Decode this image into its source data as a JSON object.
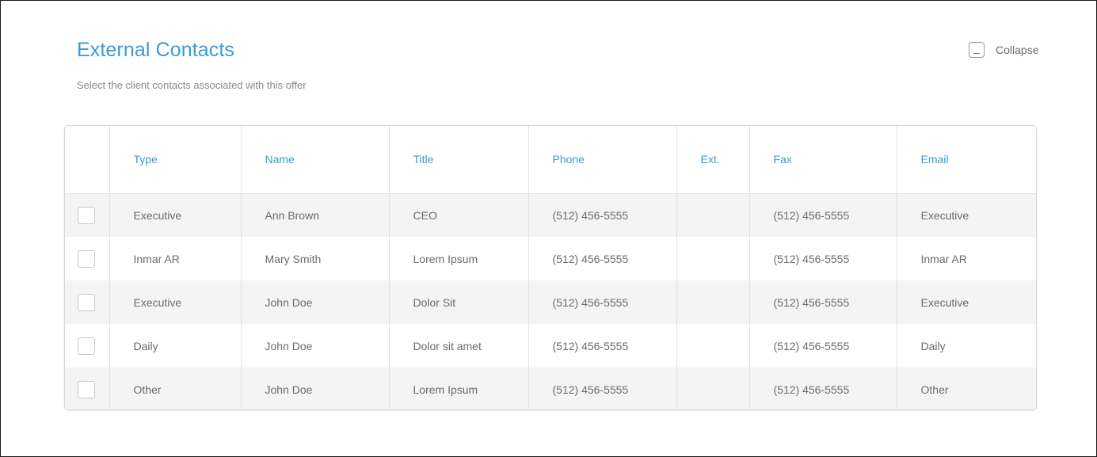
{
  "header": {
    "title": "External Contacts",
    "subtitle": "Select the client contacts associated with this offer",
    "collapse_label": "Collapse"
  },
  "table": {
    "columns": [
      "Type",
      "Name",
      "Title",
      "Phone",
      "Ext.",
      "Fax",
      "Email"
    ],
    "rows": [
      {
        "type": "Executive",
        "name": "Ann Brown",
        "title": "CEO",
        "phone": "(512) 456-5555",
        "ext": "",
        "fax": "(512) 456-5555",
        "email": "Executive",
        "checked": false
      },
      {
        "type": "Inmar AR",
        "name": "Mary Smith",
        "title": "Lorem Ipsum",
        "phone": "(512) 456-5555",
        "ext": "",
        "fax": "(512) 456-5555",
        "email": "Inmar AR",
        "checked": false
      },
      {
        "type": "Executive",
        "name": "John Doe",
        "title": "Dolor Sit",
        "phone": "(512) 456-5555",
        "ext": "",
        "fax": "(512) 456-5555",
        "email": "Executive",
        "checked": false
      },
      {
        "type": "Daily",
        "name": "John Doe",
        "title": "Dolor sit amet",
        "phone": "(512) 456-5555",
        "ext": "",
        "fax": "(512) 456-5555",
        "email": "Daily",
        "checked": false
      },
      {
        "type": "Other",
        "name": "John Doe",
        "title": "Lorem Ipsum",
        "phone": "(512) 456-5555",
        "ext": "",
        "fax": "(512) 456-5555",
        "email": "Other",
        "checked": false
      }
    ]
  },
  "colors": {
    "accent": "#3d9ad7",
    "row_alt": "#f4f4f4",
    "text": "#6b6b6b",
    "border": "#d6d6d6"
  },
  "icons": {
    "collapse": "collapse-icon",
    "row_select": "checkbox"
  }
}
